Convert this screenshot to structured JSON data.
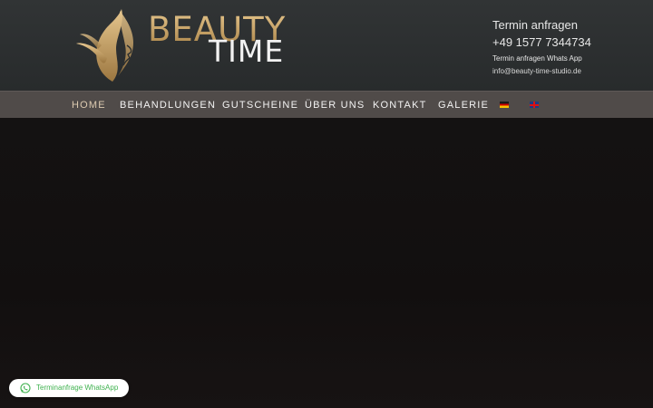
{
  "logo": {
    "line1": "BEAUTY",
    "line2": "TIME",
    "icon": "leaf-face-icon"
  },
  "contact": {
    "request": "Termin anfragen",
    "phone": "+49 1577 7344734",
    "whatsapp": "Termin anfragen Whats App",
    "email": "info@beauty-time-studio.de"
  },
  "nav": {
    "home": "HOME",
    "treatments": "BEHANDLUNGEN",
    "vouchers": "GUTSCHEINE",
    "about": "ÜBER UNS",
    "contact": "KONTAKT",
    "gallery": "GALERIE",
    "lang_de": "german-flag-icon",
    "lang_en": "uk-flag-icon"
  },
  "whatsapp_button": {
    "label": "Terminanfrage WhatsApp",
    "icon": "whatsapp-icon",
    "color": "#3fb24f"
  },
  "colors": {
    "header_bg": "#2c2f30",
    "nav_bg": "#504b49",
    "gold": "#c9a56a",
    "hero_bg": "#141212"
  }
}
